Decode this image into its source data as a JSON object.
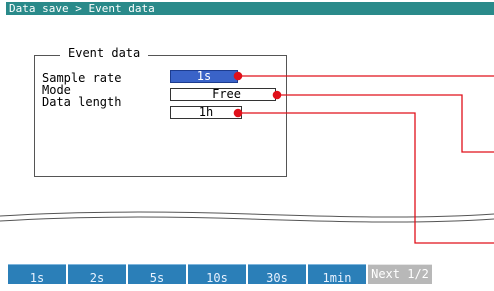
{
  "breadcrumb": "Data save > Event data",
  "panel": {
    "title": "Event data",
    "rows": [
      {
        "label": "Sample rate",
        "value": "1s",
        "selected": true
      },
      {
        "label": "Mode",
        "value": "Free",
        "selected": false
      },
      {
        "label": "Data length",
        "value": "1h",
        "selected": false
      }
    ]
  },
  "function_keys": [
    {
      "label": "1s"
    },
    {
      "label": "2s"
    },
    {
      "label": "5s"
    },
    {
      "label": "10s"
    },
    {
      "label": "30s"
    },
    {
      "label": "1min"
    },
    {
      "label": "Next 1/2"
    }
  ],
  "colors": {
    "title_bar": "#2a8a8a",
    "selected_field": "#3a63c8",
    "callout": "#e0101a",
    "function_key": "#2b7fb8",
    "next_key": "#b8b8b8"
  }
}
